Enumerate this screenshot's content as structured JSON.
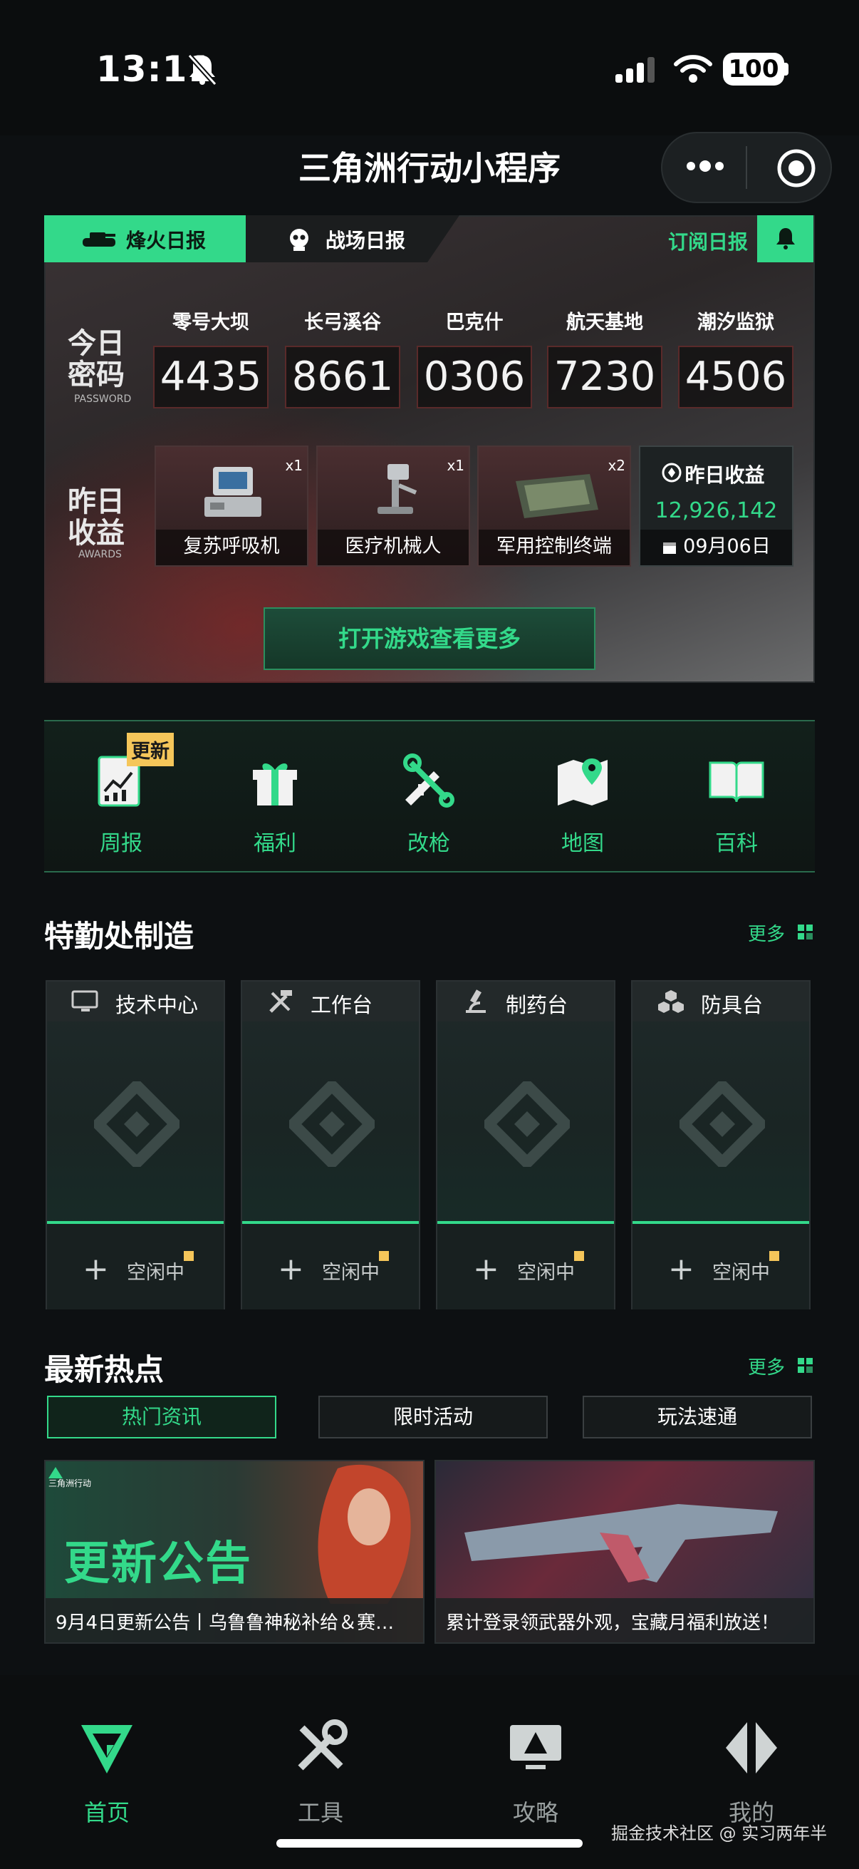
{
  "status_bar": {
    "time": "13:11",
    "battery": "100"
  },
  "app": {
    "title": "三角洲行动小程序"
  },
  "report": {
    "tab_active": "烽火日报",
    "tab_other": "战场日报",
    "subscribe": "订阅日报",
    "password_label": "今日密码",
    "password_sub": "PASSWORD",
    "maps": [
      {
        "name": "零号大坝",
        "code": "4435"
      },
      {
        "name": "长弓溪谷",
        "code": "8661"
      },
      {
        "name": "巴克什",
        "code": "0306"
      },
      {
        "name": "航天基地",
        "code": "7230"
      },
      {
        "name": "潮汐监狱",
        "code": "4506"
      }
    ],
    "awards_label": "昨日收益",
    "awards_sub": "AWARDS",
    "items": [
      {
        "name": "复苏呼吸机",
        "qty": "x1"
      },
      {
        "name": "医疗机械人",
        "qty": "x1"
      },
      {
        "name": "军用控制终端",
        "qty": "x2"
      }
    ],
    "earnings": {
      "title": "昨日收益",
      "value": "12,926,142",
      "date": "09月06日"
    },
    "open_button": "打开游戏查看更多"
  },
  "quick_nav": {
    "badge": "更新",
    "items": [
      {
        "label": "周报",
        "icon": "weekly-report-icon"
      },
      {
        "label": "福利",
        "icon": "gift-icon"
      },
      {
        "label": "改枪",
        "icon": "gun-wrench-icon"
      },
      {
        "label": "地图",
        "icon": "map-pin-icon"
      },
      {
        "label": "百科",
        "icon": "book-icon"
      }
    ]
  },
  "special_ops": {
    "title": "特勤处制造",
    "more": "更多",
    "stations": [
      {
        "name": "技术中心",
        "status": "空闲中"
      },
      {
        "name": "工作台",
        "status": "空闲中"
      },
      {
        "name": "制药台",
        "status": "空闲中"
      },
      {
        "name": "防具台",
        "status": "空闲中"
      }
    ]
  },
  "news": {
    "title": "最新热点",
    "more": "更多",
    "tabs": [
      "热门资讯",
      "限时活动",
      "玩法速通"
    ],
    "cards": [
      {
        "caption": "9月4日更新公告丨乌鲁鲁神秘补给＆赛…",
        "overlay_title": "更新公告",
        "brand": "三角洲行动"
      },
      {
        "caption": "累计登录领武器外观，宝藏月福利放送！"
      }
    ]
  },
  "tabbar": {
    "items": [
      {
        "label": "首页",
        "active": true
      },
      {
        "label": "工具",
        "active": false
      },
      {
        "label": "攻略",
        "active": false
      },
      {
        "label": "我的",
        "active": false
      }
    ]
  },
  "watermark": "掘金技术社区 @ 实习两年半",
  "colors": {
    "accent": "#33d98a",
    "badge": "#f5c65a",
    "background": "#0d1012"
  }
}
